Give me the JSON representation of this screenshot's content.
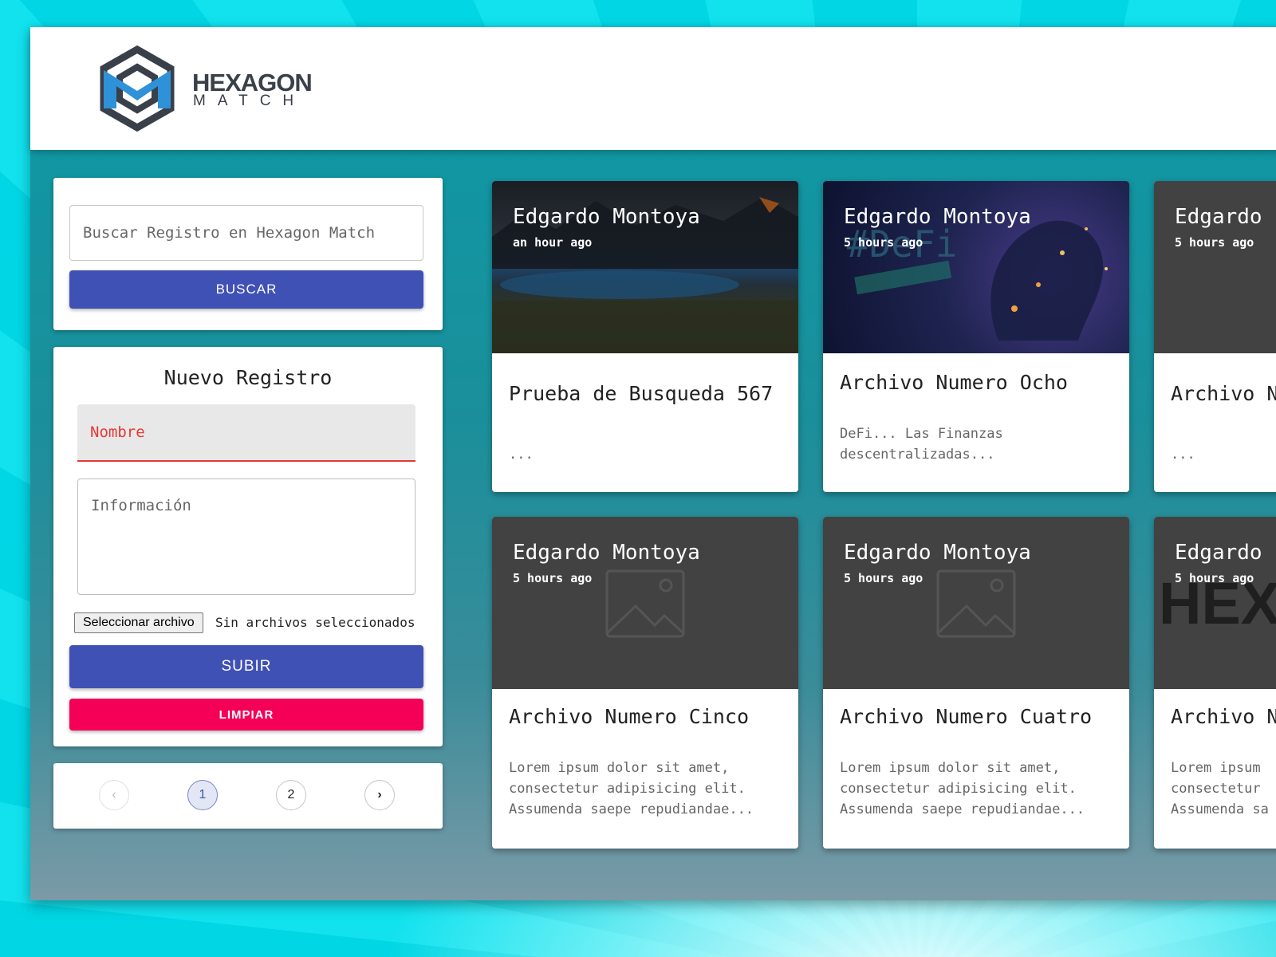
{
  "header": {
    "logo_title": "HEXAGON",
    "logo_subtitle": "MATCH",
    "logo_colors": {
      "primary": "#2f91d8",
      "secondary": "#3a4049"
    }
  },
  "search": {
    "placeholder": "Buscar Registro en Hexagon Match",
    "button_label": "BUSCAR"
  },
  "new_record": {
    "title": "Nuevo Registro",
    "name_label": "Nombre",
    "info_placeholder": "Información",
    "file_button_label": "Seleccionar archivo",
    "file_status": "Sin archivos seleccionados",
    "upload_label": "SUBIR",
    "clear_label": "LIMPIAR"
  },
  "pagination": {
    "prev_icon": "chevron-left-icon",
    "next_icon": "chevron-right-icon",
    "pages": [
      "1",
      "2"
    ],
    "current_page": "1"
  },
  "colors": {
    "primary_button": "#3f51b5",
    "clear_button": "#f50057",
    "error": "#e53935",
    "card_media_dark": "#424242"
  },
  "posts": [
    {
      "author": "Edgardo Montoya",
      "time": "an hour ago",
      "title": "Prueba de Busqueda 567",
      "excerpt": "...",
      "media": "landscape-photo"
    },
    {
      "author": "Edgardo Montoya",
      "time": "5 hours ago",
      "title": "Archivo Numero Ocho",
      "excerpt": "DeFi... Las Finanzas descentralizadas...",
      "media": "defi-photo"
    },
    {
      "author": "Edgardo",
      "time": "5 hours ago",
      "title": "Archivo N",
      "excerpt": "...",
      "media": "dark"
    },
    {
      "author": "Edgardo Montoya",
      "time": "5 hours ago",
      "title": "Archivo Numero Cinco",
      "excerpt": "Lorem ipsum dolor sit amet, consectetur adipisicing elit. Assumenda saepe repudiandae...",
      "media": "image-placeholder-icon"
    },
    {
      "author": "Edgardo Montoya",
      "time": "5 hours ago",
      "title": "Archivo Numero Cuatro",
      "excerpt": "Lorem ipsum dolor sit amet, consectetur adipisicing elit. Assumenda saepe repudiandae...",
      "media": "image-placeholder-icon"
    },
    {
      "author": "Edgardo",
      "time": "5 hours ago",
      "title": "Archivo N",
      "excerpt": "Lorem ipsum consectetur Assumenda sa",
      "media": "hexagon-logo",
      "media_text": "HEX"
    }
  ]
}
